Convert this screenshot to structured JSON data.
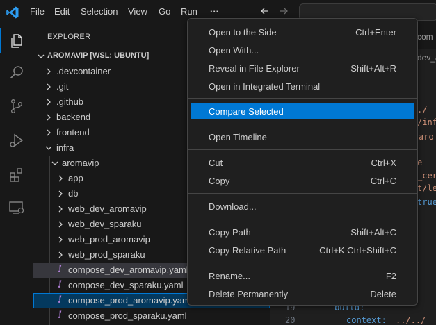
{
  "colors": {
    "accent": "#0078d4",
    "yaml_icon": "#b180d7",
    "background": "#1f1f1f",
    "sidebar": "#181818"
  },
  "titlebar": {
    "menus": [
      "File",
      "Edit",
      "Selection",
      "View",
      "Go",
      "Run",
      "···"
    ]
  },
  "activity_icons": [
    "explorer-icon",
    "search-icon",
    "source-control-icon",
    "run-debug-icon",
    "extensions-icon",
    "remote-explorer-icon"
  ],
  "explorer": {
    "title": "EXPLORER",
    "root": "AROMAVIP [WSL: UBUNTU]",
    "items": [
      {
        "label": ".devcontainer",
        "type": "folder",
        "expanded": false
      },
      {
        "label": ".git",
        "type": "folder",
        "expanded": false
      },
      {
        "label": ".github",
        "type": "folder",
        "expanded": false
      },
      {
        "label": "backend",
        "type": "folder",
        "expanded": false
      },
      {
        "label": "frontend",
        "type": "folder",
        "expanded": false
      },
      {
        "label": "infra",
        "type": "folder",
        "expanded": true
      },
      {
        "label": "aromavip",
        "type": "folder",
        "expanded": true
      },
      {
        "label": "app",
        "type": "folder",
        "expanded": false
      },
      {
        "label": "db",
        "type": "folder",
        "expanded": false
      },
      {
        "label": "web_dev_aromavip",
        "type": "folder",
        "expanded": false
      },
      {
        "label": "web_dev_sparaku",
        "type": "folder",
        "expanded": false
      },
      {
        "label": "web_prod_aromavip",
        "type": "folder",
        "expanded": false
      },
      {
        "label": "web_prod_sparaku",
        "type": "folder",
        "expanded": false
      },
      {
        "label": "compose_dev_aromavip.yaml",
        "type": "yaml"
      },
      {
        "label": "compose_dev_sparaku.yaml",
        "type": "yaml"
      },
      {
        "label": "compose_prod_aromavip.yaml",
        "type": "yaml"
      },
      {
        "label": "compose_prod_sparaku.yaml",
        "type": "yaml"
      }
    ]
  },
  "editor": {
    "tab_fragments": [
      "com",
      "dev_arc"
    ],
    "code_fragments": [
      {
        "text": "./",
        "color": "#ce9178"
      },
      {
        "text": "/inf",
        "color": "#ce9178"
      },
      {
        "text": "aro",
        "color": "#ce9178"
      },
      {
        "text": "e",
        "color": "#ce9178"
      },
      {
        "text": "_cer",
        "color": "#ce9178"
      },
      {
        "text": "t/le",
        "color": "#ce9178"
      },
      {
        "text": "true",
        "color": "#569cd6"
      },
      {
        "text": "build:",
        "color": "#569cd6"
      },
      {
        "text": "context:",
        "color": "#569cd6"
      },
      {
        "text": "../../",
        "color": "#ce9178"
      }
    ],
    "line_numbers": [
      "19",
      "20"
    ]
  },
  "context_menu": {
    "groups": [
      [
        {
          "label": "Open to the Side",
          "shortcut": "Ctrl+Enter"
        },
        {
          "label": "Open With...",
          "shortcut": ""
        },
        {
          "label": "Reveal in File Explorer",
          "shortcut": "Shift+Alt+R"
        },
        {
          "label": "Open in Integrated Terminal",
          "shortcut": ""
        }
      ],
      [
        {
          "label": "Compare Selected",
          "shortcut": "",
          "highlighted": true
        }
      ],
      [
        {
          "label": "Open Timeline",
          "shortcut": ""
        }
      ],
      [
        {
          "label": "Cut",
          "shortcut": "Ctrl+X"
        },
        {
          "label": "Copy",
          "shortcut": "Ctrl+C"
        }
      ],
      [
        {
          "label": "Download...",
          "shortcut": ""
        }
      ],
      [
        {
          "label": "Copy Path",
          "shortcut": "Shift+Alt+C"
        },
        {
          "label": "Copy Relative Path",
          "shortcut": "Ctrl+K Ctrl+Shift+C"
        }
      ],
      [
        {
          "label": "Rename...",
          "shortcut": "F2"
        },
        {
          "label": "Delete Permanently",
          "shortcut": "Delete"
        }
      ]
    ]
  }
}
